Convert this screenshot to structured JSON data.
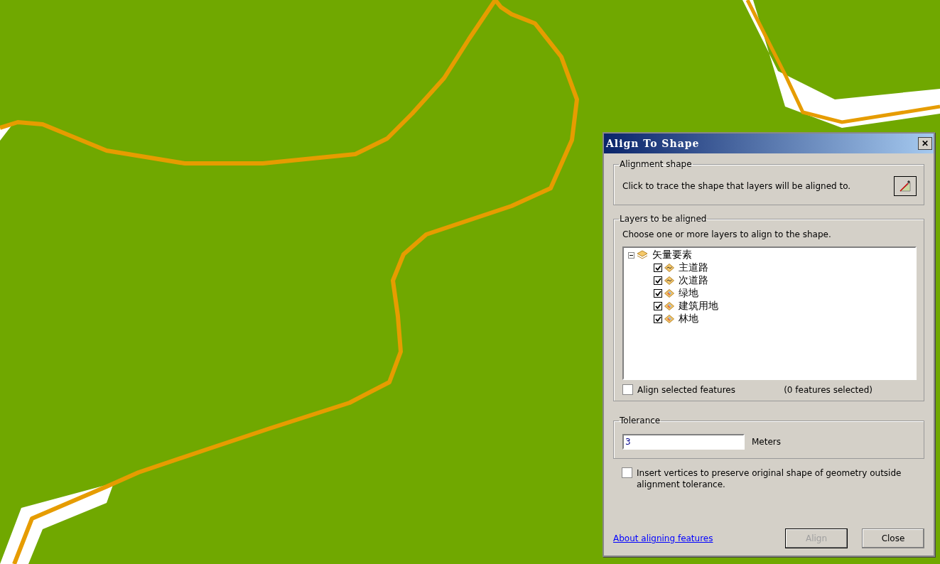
{
  "dialog": {
    "title": "Align To Shape",
    "close_label": "✕",
    "alignment_shape": {
      "legend": "Alignment shape",
      "instruction": "Click to trace the shape that layers will be aligned to."
    },
    "layers": {
      "legend": "Layers to be aligned",
      "instruction": "Choose one or more layers to align to the shape.",
      "tree": [
        {
          "label": "矢量要素",
          "expanded": true,
          "children": [
            {
              "label": "主道路",
              "kind": "line",
              "checked": true
            },
            {
              "label": "次道路",
              "kind": "line",
              "checked": true
            },
            {
              "label": "绿地",
              "kind": "polygon",
              "checked": true
            },
            {
              "label": "建筑用地",
              "kind": "polygon",
              "checked": true
            },
            {
              "label": "林地",
              "kind": "polygon",
              "checked": true
            }
          ]
        }
      ],
      "align_selected": {
        "label": "Align selected features",
        "checked": false
      },
      "selected_count": "(0 features selected)"
    },
    "tolerance": {
      "legend": "Tolerance",
      "value": "3",
      "unit": "Meters"
    },
    "insert_vertices": {
      "label": "Insert vertices to preserve original shape of geometry outside alignment tolerance.",
      "checked": false
    },
    "help_link": "About aligning features",
    "buttons": [
      {
        "label": "Align",
        "disabled": true
      },
      {
        "label": "Close",
        "disabled": false
      }
    ]
  }
}
